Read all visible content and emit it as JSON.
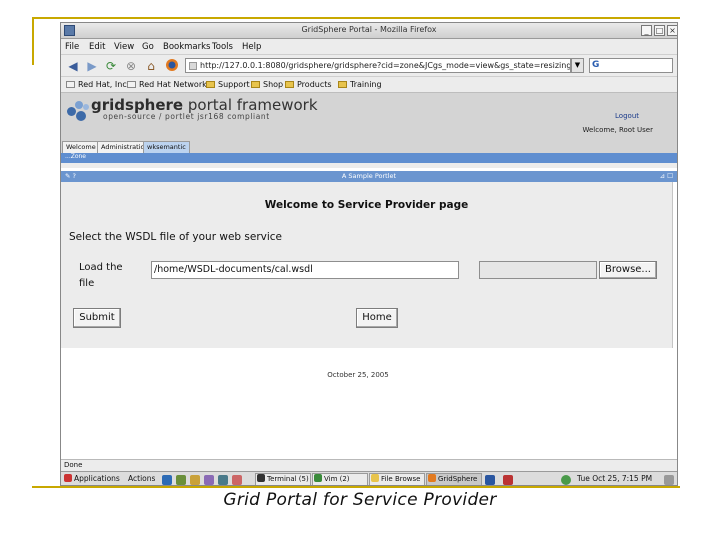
{
  "caption": "Grid Portal for Service Provider",
  "window": {
    "title": "GridSphere Portal - Mozilla Firefox",
    "controls": [
      "_",
      "□",
      "×"
    ]
  },
  "menu": [
    "File",
    "Edit",
    "View",
    "Go",
    "Bookmarks",
    "Tools",
    "Help"
  ],
  "url": "http://127.0.0.1:8080/gridsphere/gridsphere?cid=zone&JCgs_mode=view&gs_state=resizing",
  "bookmarks": [
    "Red Hat, Inc.",
    "Red Hat Network",
    "Support",
    "Shop",
    "Products",
    "Training"
  ],
  "portal": {
    "logo_bold": "gridsphere",
    "logo_rest": " portal framework",
    "logo_sub": "open-source / portlet jsr168 compliant",
    "logout": "Logout",
    "welcome_user": "Welcome, Root User",
    "tabs": [
      "Welcome",
      "Administration",
      "wksemantic"
    ],
    "subtab": "...Zone"
  },
  "portlet": {
    "title": "A Sample Portlet",
    "left_controls": "✎ ?",
    "right_controls": "⊿ ☐",
    "heading": "Welcome to Service Provider page",
    "select_label": "Select the WSDL file of your web service",
    "load_label": "Load the file",
    "path_value": "/home/WSDL-documents/cal.wsdl",
    "browse_label": "Browse...",
    "submit_label": "Submit",
    "home_label": "Home"
  },
  "footer_date": "October 25, 2005",
  "status": "Done",
  "taskbar": {
    "applications": "Applications",
    "actions": "Actions",
    "buttons": [
      "Terminal (5)",
      "Vim (2)",
      "File Browse",
      "GridSphere"
    ],
    "clock": "Tue Oct 25,  7:15 PM"
  }
}
